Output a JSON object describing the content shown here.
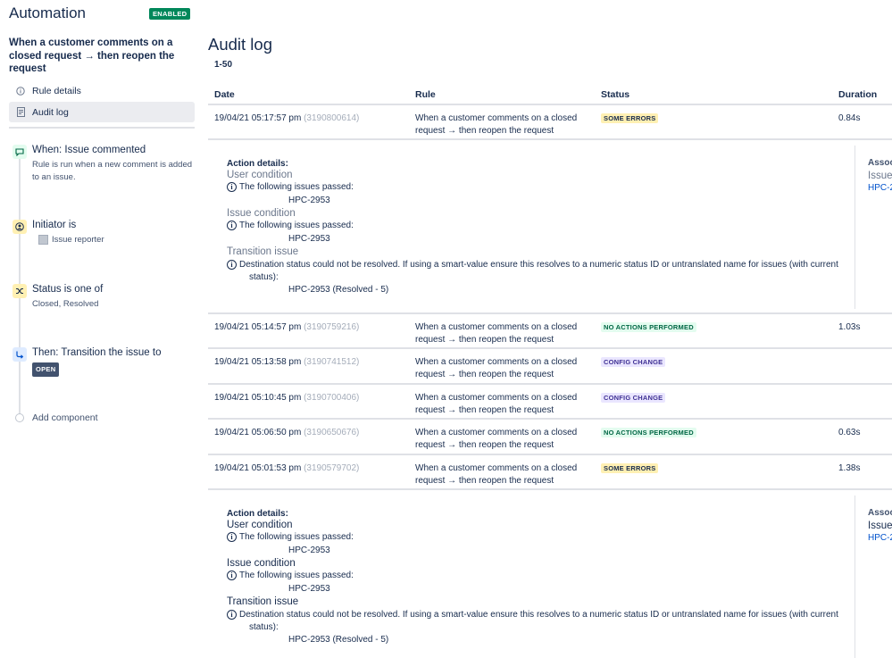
{
  "sidebar": {
    "app_title": "Automation",
    "enabled_badge": "ENABLED",
    "rule_name": "When a customer comments on a closed request → then reopen the request",
    "nav": [
      {
        "label": "Rule details",
        "icon": "info-icon"
      },
      {
        "label": "Audit log",
        "icon": "document-icon"
      }
    ],
    "steps": [
      {
        "title": "When: Issue commented",
        "subtitle": "Rule is run when a new comment is added to an issue.",
        "icon": "comment-icon"
      },
      {
        "title": "Initiator is",
        "subtitle": "Issue reporter",
        "icon": "user-icon"
      },
      {
        "title": "Status is one of",
        "subtitle": "Closed, Resolved",
        "icon": "shuffle-icon"
      },
      {
        "title": "Then: Transition the issue to",
        "subtitle": "OPEN",
        "icon": "transition-icon"
      }
    ],
    "add_component": "Add component"
  },
  "main": {
    "title": "Audit log",
    "range": "1-50",
    "columns": {
      "date": "Date",
      "rule": "Rule",
      "status": "Status",
      "duration": "Duration"
    },
    "rows": [
      {
        "date": "19/04/21 05:17:57 pm",
        "id": "(3190800614)",
        "rule": "When a customer comments on a closed request → then reopen the request",
        "status": "SOME ERRORS",
        "duration": "0.84s"
      },
      {
        "date": "19/04/21 05:14:57 pm",
        "id": "(3190759216)",
        "rule": "When a customer comments on a closed request → then reopen the request",
        "status": "NO ACTIONS PERFORMED",
        "duration": "1.03s"
      },
      {
        "date": "19/04/21 05:13:58 pm",
        "id": "(3190741512)",
        "rule": "When a customer comments on a closed request → then reopen the request",
        "status": "CONFIG CHANGE",
        "duration": ""
      },
      {
        "date": "19/04/21 05:10:45 pm",
        "id": "(3190700406)",
        "rule": "When a customer comments on a closed request → then reopen the request",
        "status": "CONFIG CHANGE",
        "duration": ""
      },
      {
        "date": "19/04/21 05:06:50 pm",
        "id": "(3190650676)",
        "rule": "When a customer comments on a closed request → then reopen the request",
        "status": "NO ACTIONS PERFORMED",
        "duration": "0.63s"
      },
      {
        "date": "19/04/21 05:01:53 pm",
        "id": "(3190579702)",
        "rule": "When a customer comments on a closed request → then reopen the request",
        "status": "SOME ERRORS",
        "duration": "1.38s"
      }
    ],
    "details": {
      "heading": "Action details:",
      "user_condition": "User condition",
      "issue_condition": "Issue condition",
      "transition_issue": "Transition issue",
      "passed_msg": "The following issues passed:",
      "issue_key": "HPC-2953",
      "error_msg_1": "Destination status could not be resolved. If using a smart-value ensure this resolves to a numeric status ID or untranslated name for issues (with current",
      "error_msg_2": "status):",
      "resolved_key": "HPC-2953 (Resolved - 5)",
      "assoc_label": "Associ",
      "assoc_issue": "Issue",
      "assoc_key": "HPC-2"
    }
  },
  "colors": {
    "enabled": "#00875a",
    "some_errors": "#fff0b3",
    "no_actions": "#e3fcef",
    "config_change": "#eae6ff",
    "link": "#0052cc"
  }
}
